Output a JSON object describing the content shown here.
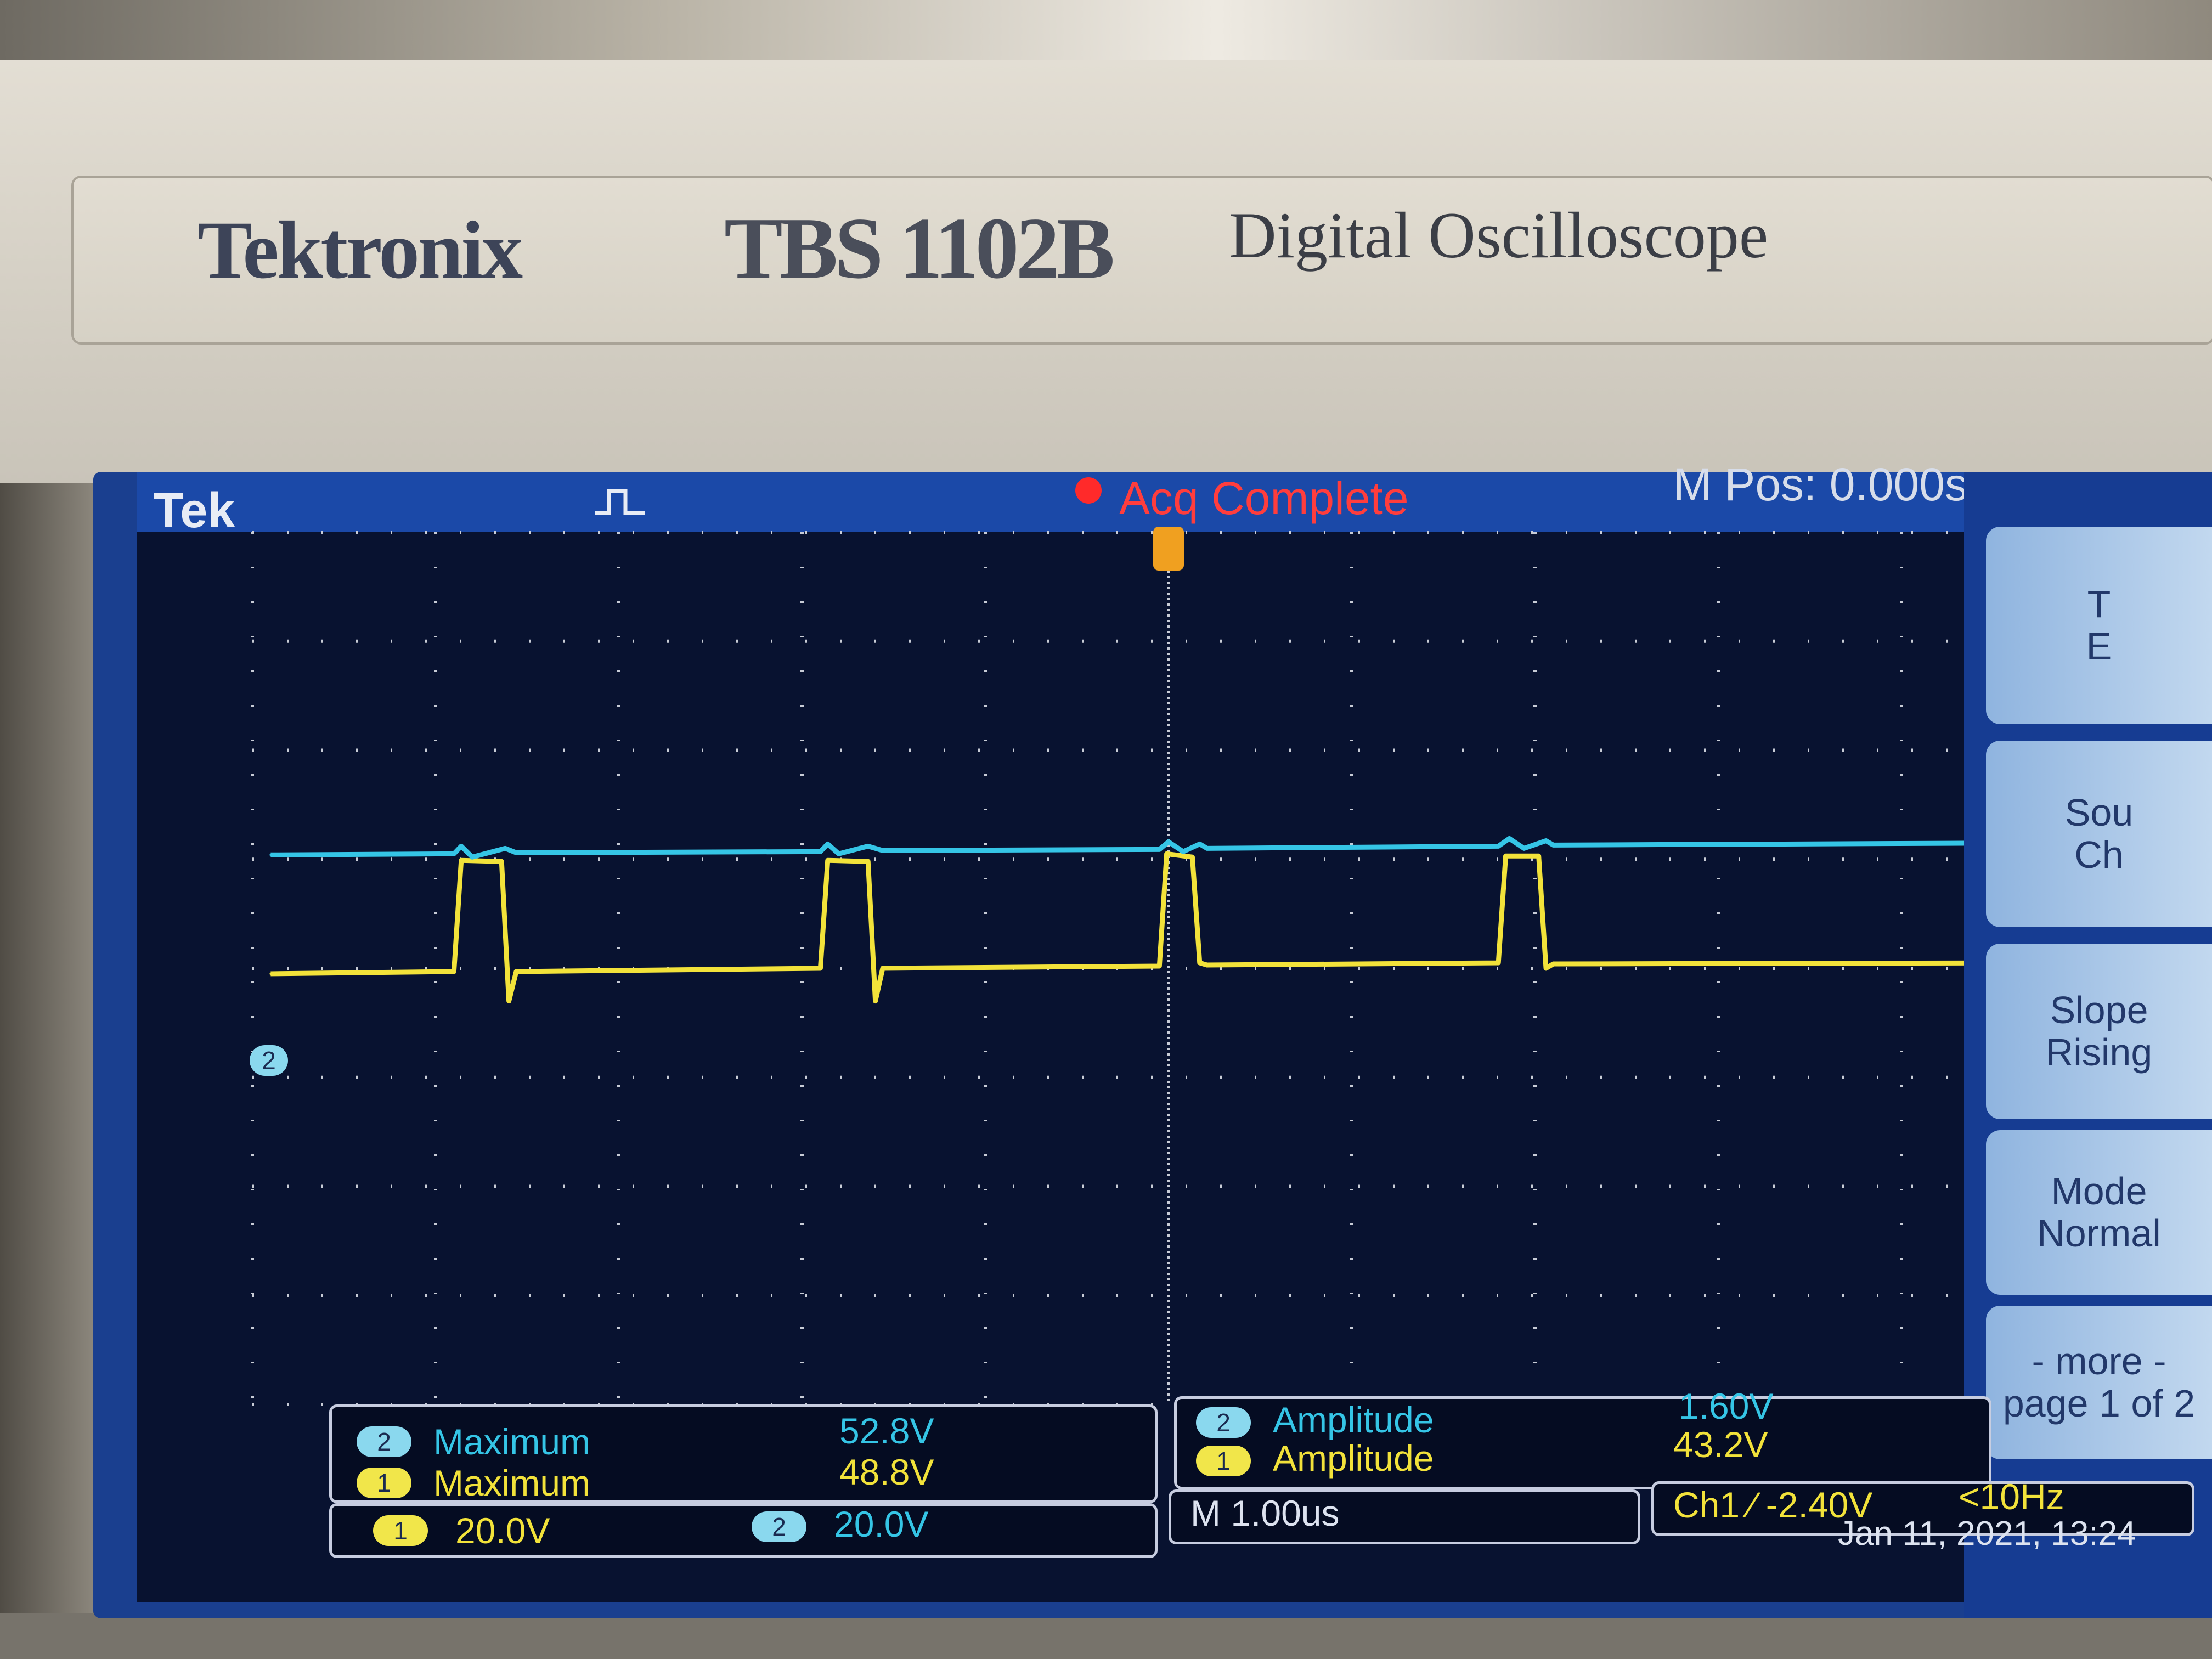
{
  "device": {
    "brand": "Tektronix",
    "model": "TBS 1102B",
    "description": "Digital Oscilloscope"
  },
  "status": {
    "logo": "Tek",
    "trigger_icon": "pulse-icon",
    "acquisition": "Acq Complete",
    "horizontal_position": "M Pos: 0.000s"
  },
  "side_menu": {
    "items": [
      {
        "line1": "T",
        "line2": "E"
      },
      {
        "line1": "Sou",
        "line2": "Ch"
      },
      {
        "line1": "Slope",
        "line2": "Rising"
      },
      {
        "line1": "Mode",
        "line2": "Normal"
      },
      {
        "line1": "- more -",
        "line2": "page 1 of 2"
      }
    ]
  },
  "measurements": {
    "left": [
      {
        "channel": "2",
        "label": "Maximum",
        "value": "52.8V"
      },
      {
        "channel": "1",
        "label": "Maximum",
        "value": "48.8V"
      }
    ],
    "right": [
      {
        "channel": "2",
        "label": "Amplitude",
        "value": "1.60V"
      },
      {
        "channel": "1",
        "label": "Amplitude",
        "value": "43.2V"
      }
    ]
  },
  "settings": {
    "ch1_badge": "1",
    "ch1_scale": "20.0V",
    "ch2_badge": "2",
    "ch2_scale": "20.0V",
    "timebase": "M 1.00us",
    "trigger": "Ch1 ∕ -2.40V",
    "frequency": "<10Hz",
    "datetime": "Jan 11, 2021, 13:24",
    "ch2_marker": "2"
  },
  "colors": {
    "ch1": "#f2e23a",
    "ch2": "#35c5e6",
    "trigger_marker": "#f0a020",
    "grid": "#c8ccd6"
  },
  "chart_data": {
    "type": "line",
    "grid": true,
    "ylim": [
      -4,
      4
    ],
    "xlim": [
      -5,
      5
    ],
    "series": [
      {
        "name": "Ch1",
        "points": [
          [
            -4.9,
            -0.05
          ],
          [
            -3.9,
            -0.03
          ],
          [
            -3.86,
            0.99
          ],
          [
            -3.64,
            0.98
          ],
          [
            -3.6,
            -0.3
          ],
          [
            -3.56,
            -0.03
          ],
          [
            -1.9,
            0.0
          ],
          [
            -1.86,
            0.99
          ],
          [
            -1.64,
            0.98
          ],
          [
            -1.6,
            -0.3
          ],
          [
            -1.56,
            0.0
          ],
          [
            -0.05,
            0.02
          ],
          [
            -0.01,
            1.05
          ],
          [
            0.13,
            1.02
          ],
          [
            0.17,
            0.05
          ],
          [
            0.21,
            0.03
          ],
          [
            1.8,
            0.05
          ],
          [
            1.84,
            1.03
          ],
          [
            2.02,
            1.03
          ],
          [
            2.06,
            0.0
          ],
          [
            2.1,
            0.04
          ],
          [
            4.7,
            0.05
          ]
        ]
      },
      {
        "name": "Ch2",
        "points": [
          [
            -4.9,
            1.04
          ],
          [
            -3.9,
            1.05
          ],
          [
            -3.86,
            1.12
          ],
          [
            -3.8,
            1.02
          ],
          [
            -3.62,
            1.1
          ],
          [
            -3.56,
            1.06
          ],
          [
            -1.9,
            1.07
          ],
          [
            -1.86,
            1.14
          ],
          [
            -1.8,
            1.05
          ],
          [
            -1.64,
            1.12
          ],
          [
            -1.56,
            1.08
          ],
          [
            -0.05,
            1.09
          ],
          [
            0.0,
            1.16
          ],
          [
            0.08,
            1.07
          ],
          [
            0.17,
            1.14
          ],
          [
            0.21,
            1.1
          ],
          [
            1.8,
            1.12
          ],
          [
            1.86,
            1.19
          ],
          [
            1.94,
            1.1
          ],
          [
            2.06,
            1.17
          ],
          [
            2.1,
            1.13
          ],
          [
            4.7,
            1.15
          ]
        ]
      }
    ]
  }
}
